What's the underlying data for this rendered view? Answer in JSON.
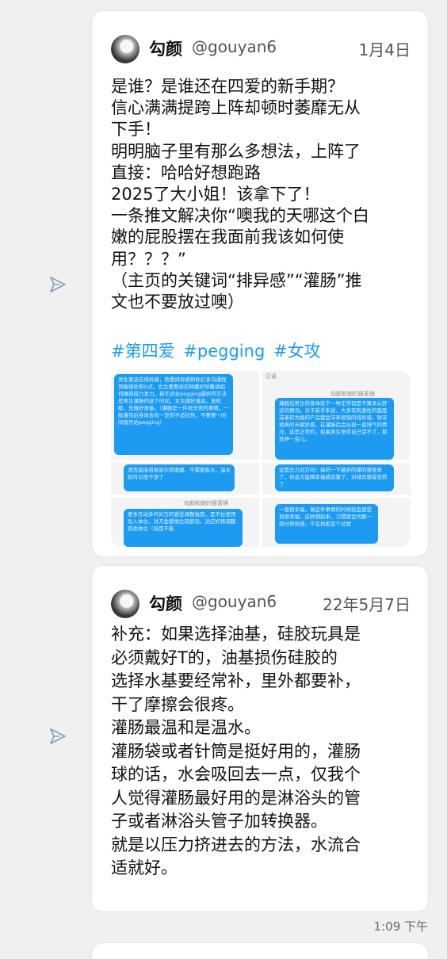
{
  "tweet1": {
    "author": "勾颜",
    "handle": "@gouyan6",
    "date": "1月4日",
    "lines": [
      "是谁？是谁还在四爱的新手期？",
      "信心满满提跨上阵却顿时萎靡无从",
      "下手！",
      "明明脑子里有那么多想法，上阵了",
      "直接：哈哈好想跑路",
      "2025了大小姐！该拿下了！",
      "一条推文解决你“噢我的天哪这个白",
      "嫩的屁股摆在我面前我该如何使",
      "用？？？”",
      "（主页的关键词“排异感”“灌肠”推",
      "文也不要放过噢）"
    ],
    "hashtags": [
      "#第四爱",
      "#pegging",
      "#女攻"
    ],
    "screenshots": {
      "top_left_text": "男生要适应排异感，熟悉排异感和你们多沟通找到敏感处和G点。女生要要适应佩戴好穿戴讲如何操部借力发力。新手适合pegging最好的方法是男生灌肠的这个时间，女生摆好道具，放松歇，先做好准备。（灌肠是一件很辛苦的事情，一般灌完后身体会有一定的不适应性，不要第一时间就开始pegging）",
      "top_right_text": "灌肠后男生的身体处于一种正常但是不算多么舒适的情况。对于新手来说，大多有刺激性的弧度或者较为粗的产品都会带来很强的排异感。除非他真的天赋异禀。在灌肠后会出现一直排气的情况，这是正常的，如果男生觉得自己受不了，那就停一会儿。",
      "top_right_text2": "这是压力对方吗！搞的一下被弄的撑的感觉来了，你会大猛鳞幸福感双骤了，对排异感受变转了",
      "mid_left_text": "清洗直接用淋浴头转换器，不需要盐水，温水就可以很干净了",
      "mid_caption": "勾颜和她的报喜镜",
      "bottom_left_text": "要多互动多问对方的感受调整角度，是不拉使用后入体位，对方会感觉比较舒适。适应好再调整其他体位（但是不能",
      "bottom_right_text": "一直很幸福，做这件事情的时候就会感受到很幸福，这样想起来，习惯就会代解一部分排异感，不会抗拒这个过程",
      "read_label": "已读"
    }
  },
  "tweet2": {
    "author": "勾颜",
    "handle": "@gouyan6",
    "date": "22年5月7日",
    "lines": [
      "补充：如果选择油基，硅胶玩具是",
      "必须戴好T的，油基损伤硅胶的",
      "选择水基要经常补，里外都要补，",
      "干了摩擦会很疼。",
      "灌肠最温和是温水。",
      "灌肠袋或者针筒是挺好用的，灌肠",
      "球的话，水会吸回去一点，仅我个",
      "人觉得灌肠最好用的是淋浴头的管",
      "子或者淋浴头管子加转换器。",
      "就是以压力挤进去的方法，水流合",
      "适就好。"
    ]
  },
  "message_time": "1:09 下午",
  "colors": {
    "accent": "#1d9bf0",
    "background": "#f0f0f0",
    "card": "#ffffff"
  },
  "icons": {
    "send": "send-icon"
  }
}
